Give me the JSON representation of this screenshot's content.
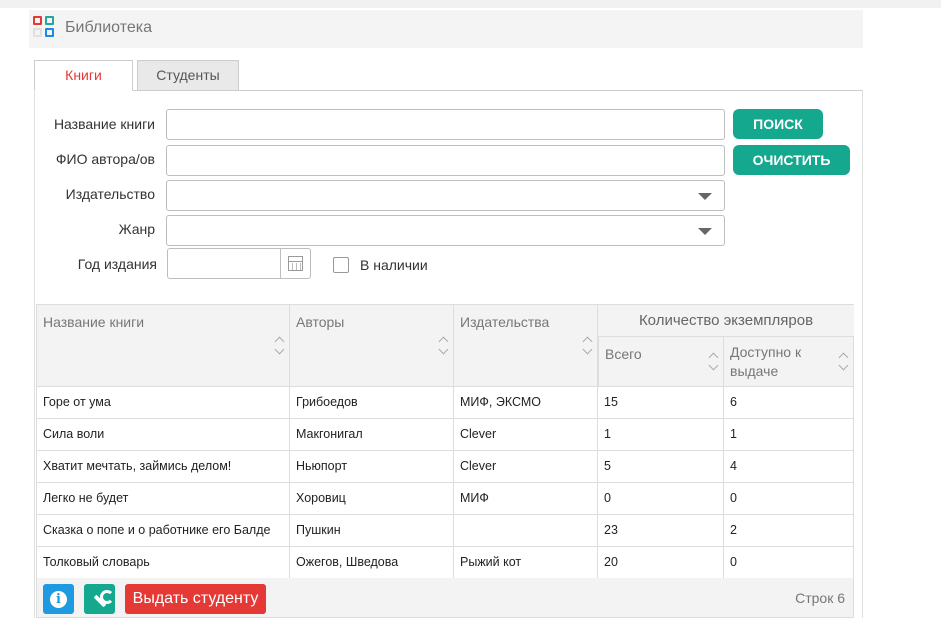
{
  "app": {
    "title": "Библиотека"
  },
  "tabs": [
    {
      "label": "Книги",
      "active": true
    },
    {
      "label": "Студенты",
      "active": false
    }
  ],
  "filters": {
    "title_label": "Название книги",
    "title_value": "",
    "author_label": "ФИО автора/ов",
    "author_value": "",
    "publisher_label": "Издательство",
    "publisher_value": "",
    "genre_label": "Жанр",
    "genre_value": "",
    "year_label": "Год издания",
    "year_value": "",
    "available_label": "В наличии",
    "available_checked": false,
    "search_button": "ПОИСК",
    "clear_button": "ОЧИСТИТЬ"
  },
  "table": {
    "headers": {
      "title": "Название книги",
      "authors": "Авторы",
      "publishers": "Издательства",
      "copies_group": "Количество экземпляров",
      "total": "Всего",
      "available": "Доступно к выдаче"
    },
    "rows": [
      {
        "title": "Горе от ума",
        "authors": "Грибоедов",
        "publishers": "МИФ, ЭКСМО",
        "total": "15",
        "available": "6"
      },
      {
        "title": "Сила воли",
        "authors": "Макгонигал",
        "publishers": "Clever",
        "total": "1",
        "available": "1"
      },
      {
        "title": "Хватит мечтать, займись делом!",
        "authors": "Ньюпорт",
        "publishers": "Clever",
        "total": "5",
        "available": "4"
      },
      {
        "title": "Легко не будет",
        "authors": "Хоровиц",
        "publishers": "МИФ",
        "total": "0",
        "available": "0"
      },
      {
        "title": "Сказка о попе и о работнике его Балде",
        "authors": "Пушкин",
        "publishers": "",
        "total": "23",
        "available": "2"
      },
      {
        "title": "Толковый словарь",
        "authors": "Ожегов, Шведова",
        "publishers": "Рыжий кот",
        "total": "20",
        "available": "0"
      }
    ]
  },
  "footer": {
    "issue_button": "Выдать студенту",
    "row_count": "Строк 6"
  },
  "colors": {
    "accent_red": "#e53935",
    "accent_green": "#14a88e",
    "accent_blue": "#1e9be0"
  }
}
